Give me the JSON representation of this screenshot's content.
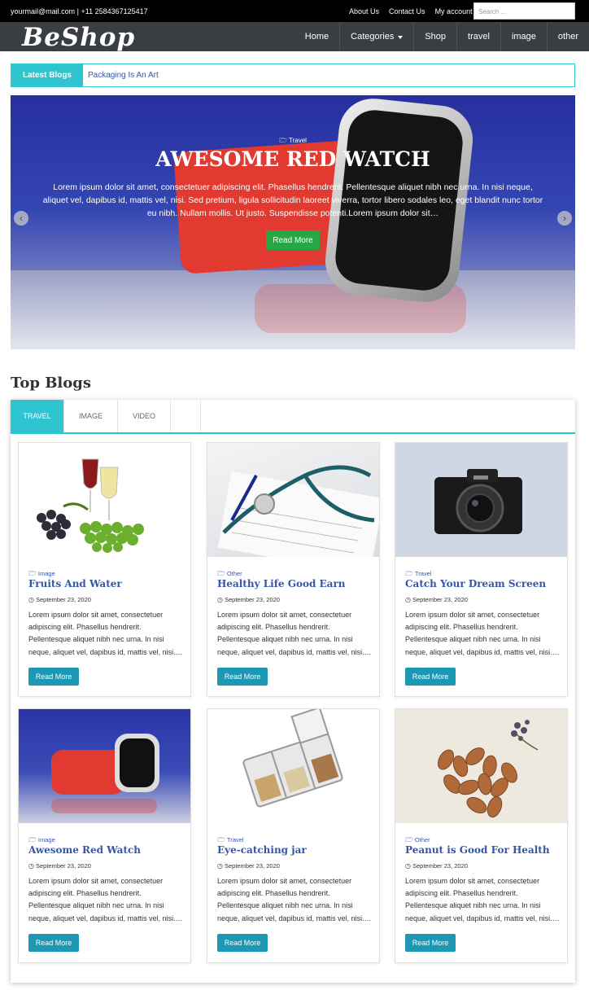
{
  "topbar": {
    "contact": "yourmail@mail.com | +11 2584367125417",
    "links": [
      "About Us",
      "Contact Us",
      "My account"
    ],
    "search_placeholder": "Search ..."
  },
  "header": {
    "logo": "BeShop",
    "nav": [
      "Home",
      "Categories",
      "Shop",
      "travel",
      "image",
      "other"
    ]
  },
  "ticker": {
    "label": "Latest Blogs",
    "text": "Packaging Is An Art"
  },
  "hero": {
    "category": "Travel",
    "title": "AWESOME RED WATCH",
    "excerpt": "Lorem ipsum dolor sit amet, consectetuer adipiscing elit. Phasellus hendrerit. Pellentesque aliquet nibh nec urna. In nisi neque, aliquet vel, dapibus id, mattis vel, nisi. Sed pretium, ligula sollicitudin laoreet viverra, tortor libero sodales leo, eget blandit nunc tortor eu nibh. Nullam mollis. Ut justo. Suspendisse potenti.Lorem ipsum dolor sit…",
    "button": "Read More",
    "prev_icon": "chevron-left-icon",
    "next_icon": "chevron-right-icon"
  },
  "top_blogs": {
    "title": "Top Blogs",
    "tabs": [
      "TRAVEL",
      "IMAGE",
      "VIDEO"
    ],
    "active_tab": "TRAVEL",
    "accent_color": "#2ec5d0",
    "posts": [
      {
        "category": "Image",
        "title": "Fruits And Water",
        "date": "September 23, 2020",
        "excerpt": "Lorem ipsum dolor sit amet, consectetuer adipiscing elit. Phasellus hendrerit. Pellentesque aliquet nibh nec urna. In nisi neque, aliquet vel, dapibus id, mattis vel, nisi.…",
        "button": "Read More"
      },
      {
        "category": "Other",
        "title": "Healthy Life Good Earn",
        "date": "September 23, 2020",
        "excerpt": "Lorem ipsum dolor sit amet, consectetuer adipiscing elit. Phasellus hendrerit. Pellentesque aliquet nibh nec urna. In nisi neque, aliquet vel, dapibus id, mattis vel, nisi.…",
        "button": "Read More"
      },
      {
        "category": "Travel",
        "title": "Catch Your Dream Screen",
        "date": "September 23, 2020",
        "excerpt": "Lorem ipsum dolor sit amet, consectetuer adipiscing elit. Phasellus hendrerit. Pellentesque aliquet nibh nec urna. In nisi neque, aliquet vel, dapibus id, mattis vel, nisi.…",
        "button": "Read More"
      },
      {
        "category": "Image",
        "title": "Awesome Red Watch",
        "date": "September 23, 2020",
        "excerpt": "Lorem ipsum dolor sit amet, consectetuer adipiscing elit. Phasellus hendrerit. Pellentesque aliquet nibh nec urna. In nisi neque, aliquet vel, dapibus id, mattis vel, nisi.…",
        "button": "Read More"
      },
      {
        "category": "Travel",
        "title": "Eye-catching jar",
        "date": "September 23, 2020",
        "excerpt": "Lorem ipsum dolor sit amet, consectetuer adipiscing elit. Phasellus hendrerit. Pellentesque aliquet nibh nec urna. In nisi neque, aliquet vel, dapibus id, mattis vel, nisi.…",
        "button": "Read More"
      },
      {
        "category": "Other",
        "title": "Peanut is Good For Health",
        "date": "September 23, 2020",
        "excerpt": "Lorem ipsum dolor sit amet, consectetuer adipiscing elit. Phasellus hendrerit. Pellentesque aliquet nibh nec urna. In nisi neque, aliquet vel, dapibus id, mattis vel, nisi.…",
        "button": "Read More"
      }
    ]
  }
}
